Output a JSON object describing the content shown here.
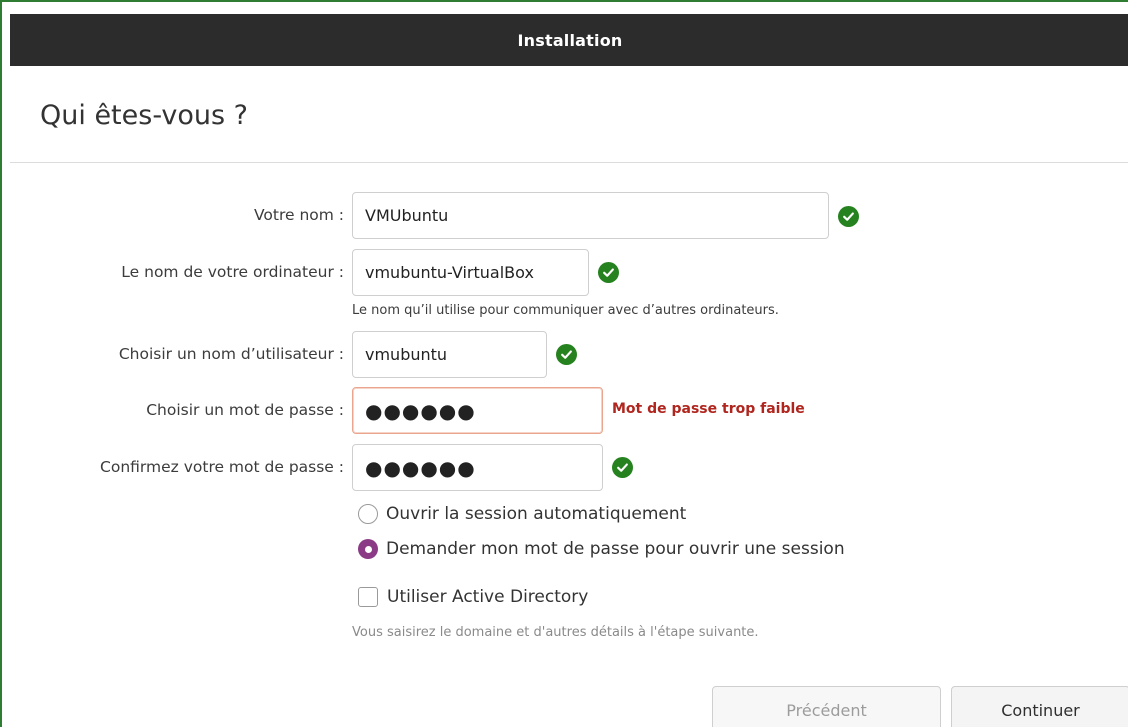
{
  "window": {
    "title": "Installation"
  },
  "page": {
    "heading": "Qui êtes-vous ?"
  },
  "form": {
    "name": {
      "label": "Votre nom :",
      "value": "VMUbuntu",
      "valid": true
    },
    "computer": {
      "label": "Le nom de votre ordinateur :",
      "value": "vmubuntu-VirtualBox",
      "valid": true,
      "hint": "Le nom qu’il utilise pour communiquer avec d’autres ordinateurs."
    },
    "username": {
      "label": "Choisir un nom d’utilisateur :",
      "value": "vmubuntu",
      "valid": true
    },
    "password": {
      "label": "Choisir un mot de passe :",
      "masked": "●●●●●●",
      "error": "Mot de passe trop faible"
    },
    "confirm": {
      "label": "Confirmez votre mot de passe :",
      "masked": "●●●●●●",
      "valid": true
    }
  },
  "login_options": {
    "auto": {
      "label": "Ouvrir la session automatiquement",
      "selected": false
    },
    "ask_password": {
      "label": "Demander mon mot de passe pour ouvrir une session",
      "selected": true
    }
  },
  "active_directory": {
    "label": "Utiliser Active Directory",
    "checked": false,
    "hint": "Vous saisirez le domaine et d'autres détails à l'étape suivante."
  },
  "buttons": {
    "back": "Précédent",
    "continue": "Continuer"
  },
  "colors": {
    "valid": "#26821f",
    "error": "#b0261e",
    "radio_selected": "#8b3b86",
    "titlebar": "#2c2c2c"
  },
  "icons": {
    "valid": "check-circle-icon"
  }
}
